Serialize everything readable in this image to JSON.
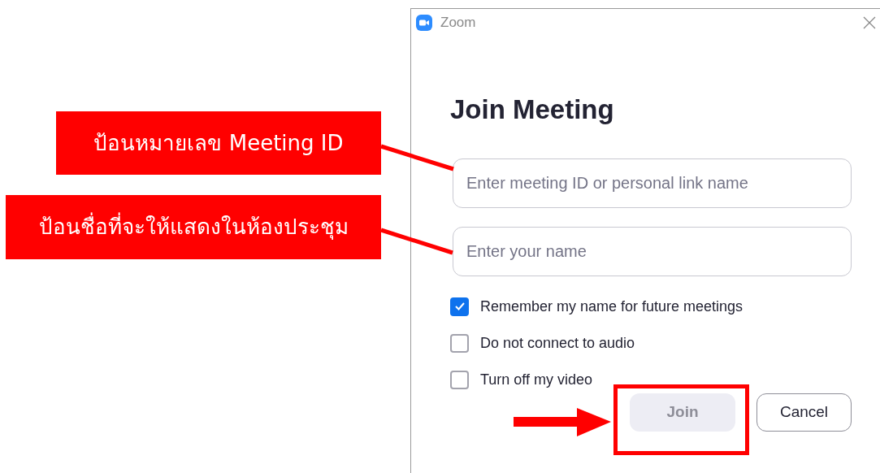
{
  "window": {
    "title": "Zoom"
  },
  "heading": "Join Meeting",
  "fields": [
    {
      "placeholder": "Enter meeting ID or personal link name"
    },
    {
      "placeholder": "Enter your name"
    }
  ],
  "options": [
    {
      "label": "Remember my name for future meetings",
      "checked": true
    },
    {
      "label": "Do not connect to audio",
      "checked": false
    },
    {
      "label": "Turn off my video",
      "checked": false
    }
  ],
  "buttons": [
    {
      "label": "Join",
      "disabled": true
    },
    {
      "label": "Cancel",
      "disabled": false
    }
  ],
  "annotations": [
    {
      "text": "ป้อนหมายเลข Meeting ID"
    },
    {
      "text": "ป้อนชื่อที่จะให้แสดงในห้องประชุม"
    }
  ]
}
